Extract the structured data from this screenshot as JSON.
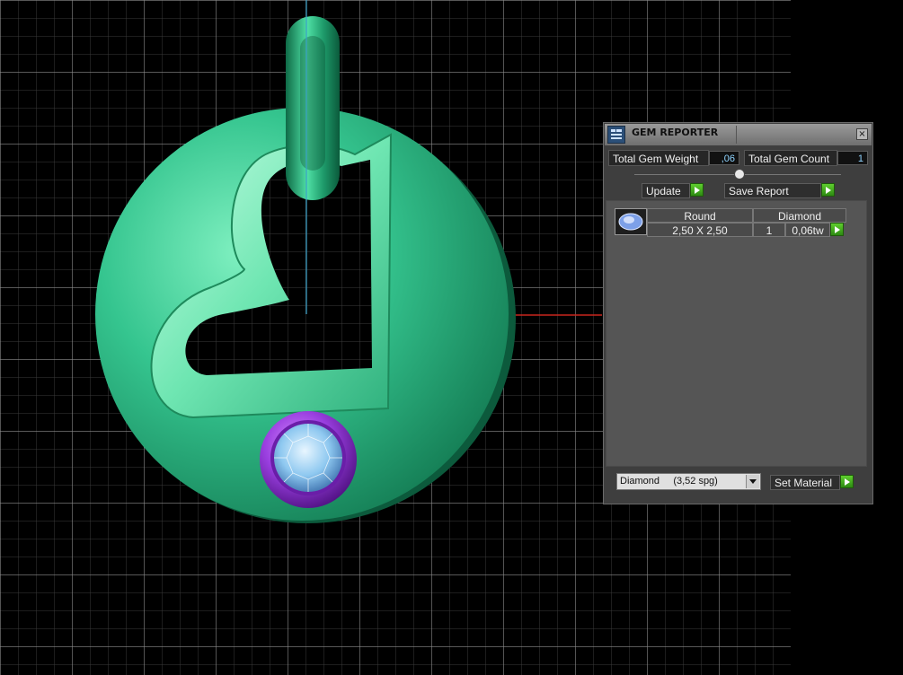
{
  "gem_reporter": {
    "title": "GEM REPORTER",
    "close_glyph": "×",
    "total_weight_label": "Total Gem Weight",
    "total_weight_value": ",06",
    "total_count_label": "Total Gem Count",
    "total_count_value": "1",
    "update_label": "Update",
    "save_report_label": "Save Report",
    "gem_rows": [
      {
        "shape": "Round",
        "material": "Diamond",
        "size": "2,50 X 2,50",
        "count": "1",
        "weight": "0,06tw"
      }
    ],
    "material_select": {
      "name": "Diamond",
      "density": "(3,52 spg)"
    },
    "set_material_label": "Set Material"
  },
  "colors": {
    "accent_go": "#3fae1c",
    "viewport_bg": "#000000",
    "pendant_green": "#1f9a6a",
    "gem_setting": "#8a2bd6"
  },
  "icons": {
    "title": "gem-reporter-app-icon",
    "close": "close-icon",
    "go": "play-arrow-icon",
    "dropdown": "chevron-down-icon",
    "gem": "round-diamond-icon"
  }
}
